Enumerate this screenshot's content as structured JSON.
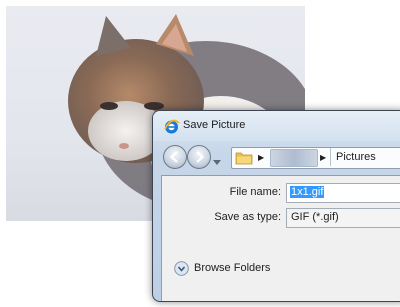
{
  "dialog": {
    "title": "Save Picture",
    "title_icon": "ie-icon"
  },
  "navbar": {
    "back_icon": "back-arrow-icon",
    "forward_icon": "forward-arrow-icon",
    "path": [
      "Pictures"
    ]
  },
  "form": {
    "file_name_label": "File name:",
    "file_name_value": "1x1.gif",
    "save_type_label": "Save as type:",
    "save_type_value": "GIF (*.gif)"
  },
  "footer": {
    "browse_label": "Browse Folders"
  },
  "colors": {
    "selection": "#3399ff",
    "dialog_border": "#3d4452"
  }
}
